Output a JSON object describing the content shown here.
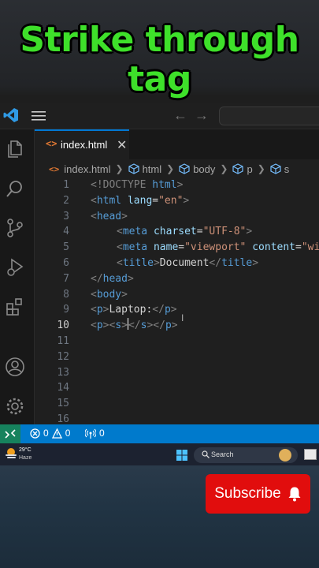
{
  "title": {
    "line1": "Strike through",
    "line2": "tag"
  },
  "titlebar": {
    "back": "←",
    "forward": "→"
  },
  "tab": {
    "icon": "<>",
    "label": "index.html",
    "close": "✕"
  },
  "breadcrumbs": {
    "file": "index.html",
    "items": [
      "html",
      "body",
      "p",
      "s"
    ]
  },
  "code": {
    "line_numbers": [
      "1",
      "2",
      "3",
      "4",
      "5",
      "6",
      "7",
      "8",
      "9",
      "10",
      "11",
      "12",
      "13",
      "14",
      "15",
      "16"
    ],
    "active_line": "10",
    "l1": {
      "a": "<!DOCTYPE ",
      "b": "html",
      "c": ">"
    },
    "l2": {
      "a": "<",
      "b": "html",
      "c": " lang",
      "d": "=",
      "e": "\"en\"",
      "f": ">"
    },
    "l3": {
      "a": "<",
      "b": "head",
      "c": ">"
    },
    "l4": {
      "a": "<",
      "b": "meta",
      "c": " charset",
      "d": "=",
      "e": "\"UTF-8\"",
      "f": ">"
    },
    "l5": {
      "a": "<",
      "b": "meta",
      "c": " name",
      "d": "=",
      "e": "\"viewport\"",
      "f": " content",
      "g": "=",
      "h": "\"wi"
    },
    "l6": {
      "a": "<",
      "b": "title",
      "c": ">",
      "d": "Document",
      "e": "</",
      "f": "title",
      "g": ">"
    },
    "l7": {
      "a": "</",
      "b": "head",
      "c": ">"
    },
    "l8": {
      "a": "<",
      "b": "body",
      "c": ">"
    },
    "l9": {
      "a": "<",
      "b": "p",
      "c": ">",
      "d": "Laptop:",
      "e": "</",
      "f": "p",
      "g": ">"
    },
    "l10": {
      "a": "<",
      "b": "p",
      "c": "><",
      "d": "s",
      "e": ">",
      "f": "</",
      "g": "s",
      "h": "></",
      "i": "p",
      "j": ">"
    }
  },
  "status": {
    "errors": "0",
    "warnings": "0",
    "ports": "0"
  },
  "taskbar": {
    "temp": "29°C",
    "weather": "Haze",
    "search": "Search"
  },
  "subscribe": {
    "label": "Subscribe"
  },
  "colors": {
    "accent": "#007acc",
    "title_green": "#3ee02a",
    "subscribe_red": "#e10d0d"
  },
  "icons": [
    "vscode-logo-icon",
    "menu-icon",
    "explorer-icon",
    "search-icon",
    "source-control-icon",
    "run-debug-icon",
    "extensions-icon",
    "account-icon",
    "settings-gear-icon",
    "bell-icon",
    "windows-logo-icon"
  ]
}
